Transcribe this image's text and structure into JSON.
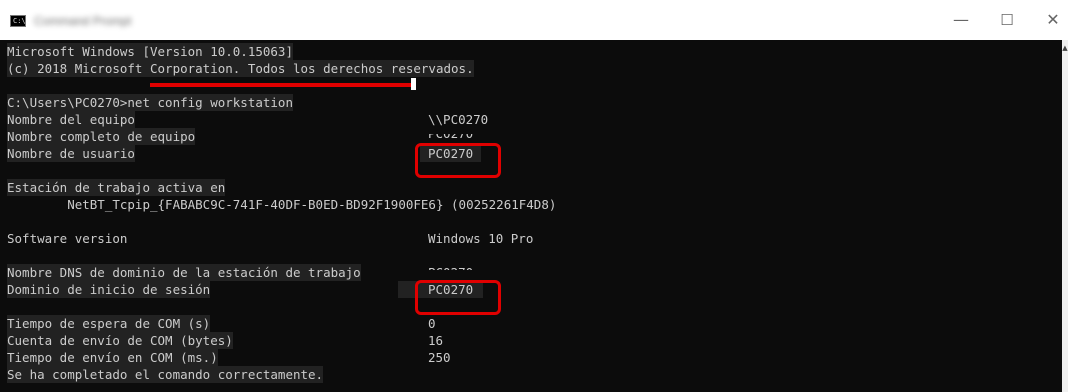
{
  "window": {
    "title": "Command Prompt",
    "icon_text": "C:\\",
    "controls": {
      "minimize": "—",
      "maximize": "☐",
      "close": "✕"
    }
  },
  "console": {
    "header_1": "Microsoft Windows [Version 10.0.15063]",
    "header_2": "(c) 2018 Microsoft Corporation. Todos los derechos reservados.",
    "command": "C:\\Users\\PC0270>net config workstation",
    "rows": {
      "computer_name": {
        "label": "Nombre del equipo",
        "value": "\\\\PC0270"
      },
      "full_computer_name": {
        "label": "Nombre completo de equipo",
        "value": "PC0270"
      },
      "user_name": {
        "label": "Nombre de usuario",
        "value": "PC0270"
      },
      "active_ws": {
        "label": "Estación de trabajo activa en",
        "value": "        NetBT_Tcpip_{FABABC9C-741F-40DF-B0ED-BD92F1900FE6} (00252261F4D8)"
      },
      "software": {
        "label": "Software version",
        "value": "Windows 10 Pro"
      },
      "dns_domain": {
        "label": "Nombre DNS de dominio de la estación de trabajo",
        "value": "PC0270"
      },
      "logon_domain": {
        "label": "Dominio de inicio de sesión",
        "value": "PC0270"
      },
      "com_timeout": {
        "label": "Tiempo de espera de COM (s)",
        "value": "0"
      },
      "com_send_count": {
        "label": "Cuenta de envío de COM (bytes)",
        "value": "16"
      },
      "com_send_timeout": {
        "label": "Tiempo de envío en COM (ms.)",
        "value": "250"
      },
      "completed": {
        "label": "Se ha completado el comando correctamente."
      }
    }
  },
  "colors": {
    "console_bg": "#0c0c0c",
    "console_text": "#cccccc",
    "highlight_red": "#e00000"
  }
}
